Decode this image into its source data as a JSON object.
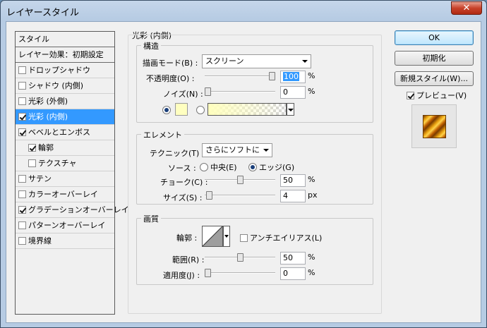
{
  "window": {
    "title": "レイヤースタイル",
    "close_label": "✕"
  },
  "sidebar": {
    "header": "スタイル",
    "blend_defaults": "レイヤー効果：初期設定",
    "items": [
      {
        "label": "ドロップシャドウ",
        "checked": false
      },
      {
        "label": "シャドウ (内側)",
        "checked": false
      },
      {
        "label": "光彩 (外側)",
        "checked": false
      },
      {
        "label": "光彩 (内側)",
        "checked": true,
        "selected": true
      },
      {
        "label": "ベベルとエンボス",
        "checked": true
      },
      {
        "label": "輪郭",
        "checked": true,
        "indent": true
      },
      {
        "label": "テクスチャ",
        "checked": false,
        "indent": true
      },
      {
        "label": "サテン",
        "checked": false
      },
      {
        "label": "カラーオーバーレイ",
        "checked": false
      },
      {
        "label": "グラデーションオーバーレイ",
        "checked": true
      },
      {
        "label": "パターンオーバーレイ",
        "checked": false
      },
      {
        "label": "境界線",
        "checked": false
      }
    ]
  },
  "panel": {
    "title": "光彩 (内側)",
    "structure": {
      "title": "構造",
      "blend_mode_label": "描画モード(B) :",
      "blend_mode_value": "スクリーン",
      "opacity_label": "不透明度(O) :",
      "opacity_value": "100",
      "opacity_unit": "%",
      "opacity_level": 1.0,
      "noise_label": "ノイズ(N) :",
      "noise_value": "0",
      "noise_unit": "%",
      "noise_level": 0.0,
      "color_swatch": "#ffffc0",
      "gradient_colors": [
        "#ffffbe",
        "#ffffff"
      ]
    },
    "elements": {
      "title": "エレメント",
      "technique_label": "テクニック(T) :",
      "technique_value": "さらにソフトに",
      "source_label": "ソース :",
      "source_center": "中央(E)",
      "source_edge": "エッジ(G)",
      "choke_label": "チョーク(C) :",
      "choke_value": "50",
      "choke_unit": "%",
      "choke_level": 0.5,
      "size_label": "サイズ(S) :",
      "size_value": "4",
      "size_unit": "px",
      "size_level": 0.02
    },
    "quality": {
      "title": "画質",
      "contour_label": "輪郭 :",
      "antialias_label": "アンチエイリアス(L)",
      "range_label": "範囲(R) :",
      "range_value": "50",
      "range_unit": "%",
      "range_level": 0.5,
      "jitter_label": "適用度(J) :",
      "jitter_value": "0",
      "jitter_unit": "%",
      "jitter_level": 0.0
    }
  },
  "buttons": {
    "ok": "OK",
    "reset": "初期化",
    "new_style": "新規スタイル(W)...",
    "preview_label": "プレビュー(V)"
  }
}
